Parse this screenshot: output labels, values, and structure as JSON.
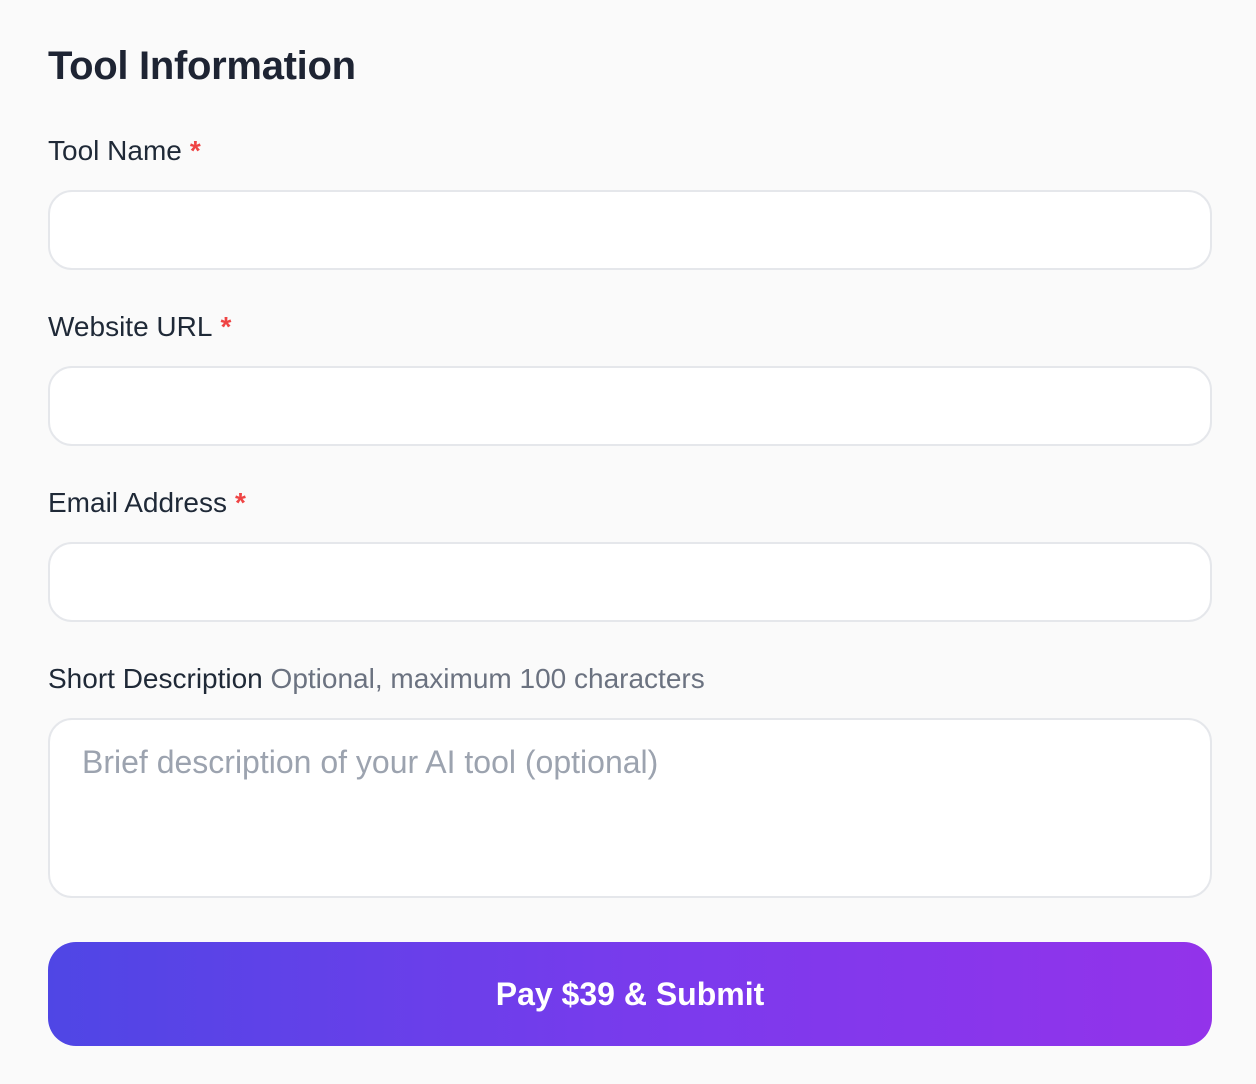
{
  "form": {
    "title": "Tool Information",
    "fields": {
      "tool_name": {
        "label": "Tool Name",
        "required_mark": "*",
        "value": "",
        "placeholder": ""
      },
      "website_url": {
        "label": "Website URL",
        "required_mark": "*",
        "value": "",
        "placeholder": ""
      },
      "email": {
        "label": "Email Address",
        "required_mark": "*",
        "value": "",
        "placeholder": ""
      },
      "description": {
        "label": "Short Description",
        "hint": "Optional, maximum 100 characters",
        "value": "",
        "placeholder": "Brief description of your AI tool (optional)"
      }
    },
    "submit_label": "Pay $39 & Submit"
  },
  "colors": {
    "required": "#ef4444",
    "gradient_start": "#4f46e5",
    "gradient_end": "#9333ea",
    "input_border": "#e5e7eb"
  }
}
